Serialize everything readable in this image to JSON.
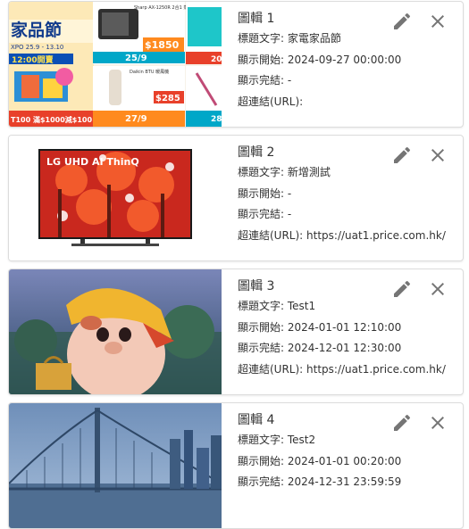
{
  "labels": {
    "title_text": "標題文字: ",
    "start": "顯示開始: ",
    "end": "顯示完結: ",
    "link": "超連結(URL): "
  },
  "banners": [
    {
      "title": "圖輯 1",
      "caption": "家電家品節",
      "start": "2024-09-27 00:00:00",
      "end": "-",
      "url": "",
      "thumb_text": {
        "headline": "家品節",
        "expo": "XPO 25.9 - 13.10",
        "time": "12:00開賣",
        "promo": "T100 滿$1000減$100",
        "oven": "Sharp AX-1250R 2合1 蒸氣焗爐",
        "price_a": "$1850",
        "date_a": "25/9",
        "heater": "Daikin BTU 暖風機",
        "price_b": "$285",
        "date_b": "27/9",
        "d_tag_1": "20",
        "d_tag_2": "28"
      }
    },
    {
      "title": "圖輯 2",
      "caption": "新增測試",
      "start": "-",
      "end": "-",
      "url": "https://uat1.price.com.hk/",
      "thumb_text": {
        "brand": "LG UHD AI ThinQ"
      }
    },
    {
      "title": "圖輯 3",
      "caption": "Test1",
      "start": "2024-01-01 12:10:00",
      "end": "2024-12-01 12:30:00",
      "url": "https://uat1.price.com.hk/"
    },
    {
      "title": "圖輯 4",
      "caption": "Test2",
      "start": "2024-01-01 00:20:00",
      "end": "2024-12-31 23:59:59",
      "url": ""
    }
  ],
  "icons": {
    "edit": "pencil-icon",
    "delete": "close-icon"
  },
  "colors": {
    "border": "#dcdcdc",
    "icon": "#757575",
    "text": "#333333"
  }
}
